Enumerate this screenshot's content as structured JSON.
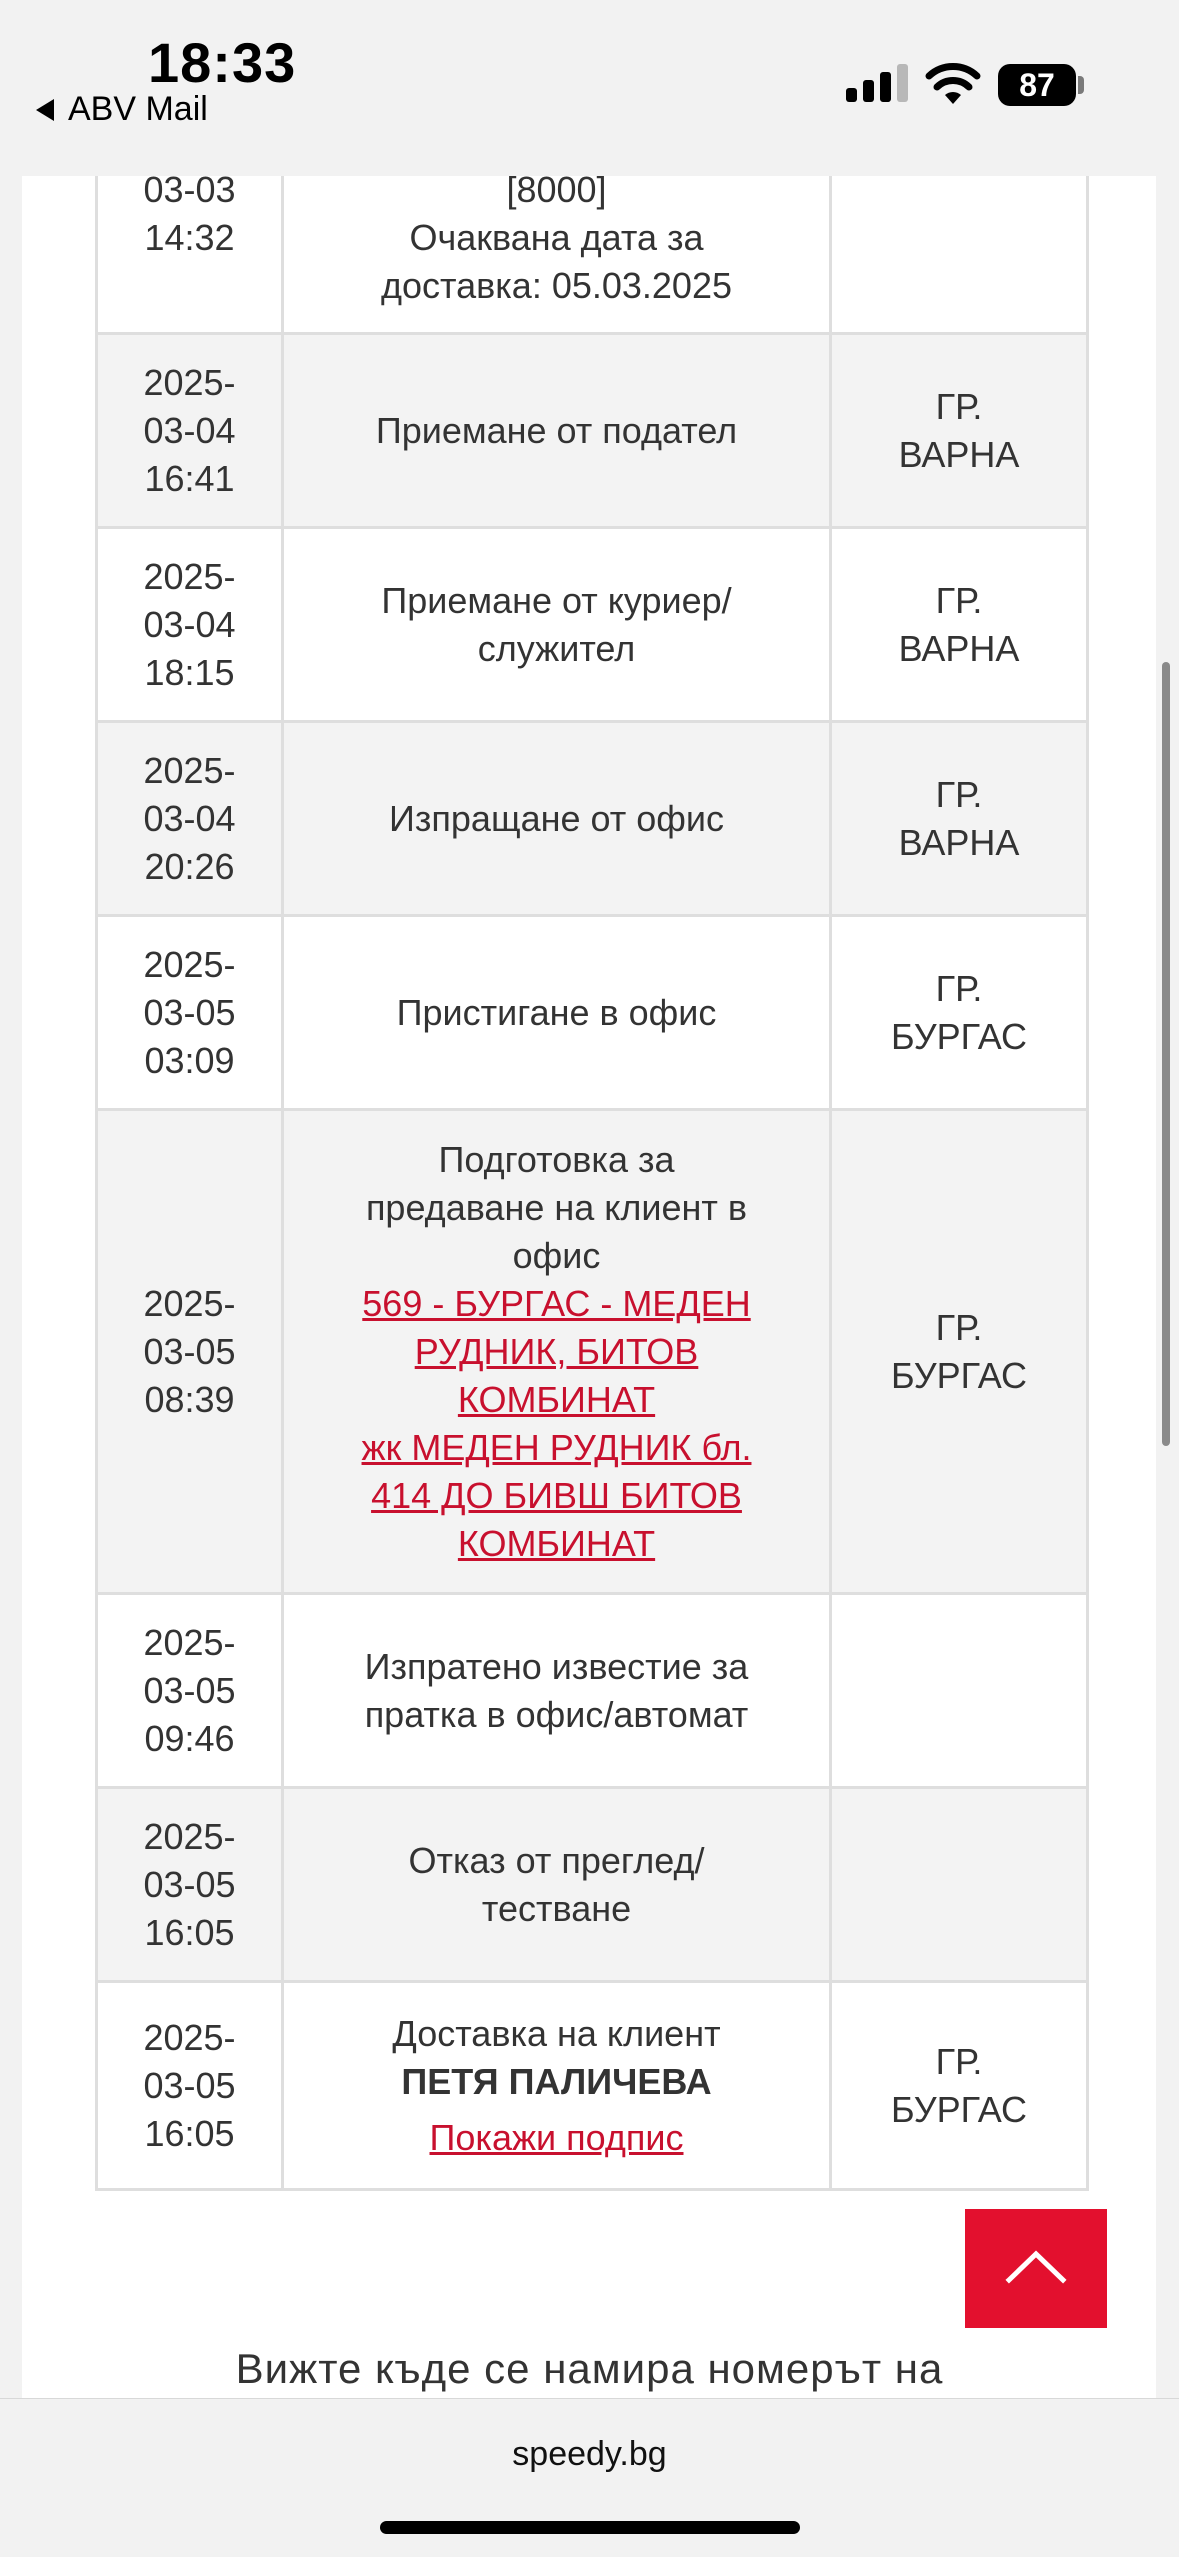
{
  "status_bar": {
    "time": "18:33",
    "back_app": "ABV Mail",
    "battery": "87"
  },
  "tracking_rows": [
    {
      "date": [
        "03-03",
        "14:32"
      ],
      "event": [
        "[8000]",
        "Очаквана дата за",
        "доставка: 05.03.2025"
      ],
      "location": []
    },
    {
      "date": [
        "2025-",
        "03-04",
        "16:41"
      ],
      "event": [
        "Приемане от подател"
      ],
      "location": [
        "ГР.",
        "ВАРНА"
      ]
    },
    {
      "date": [
        "2025-",
        "03-04",
        "18:15"
      ],
      "event": [
        "Приемане от куриер/",
        "служител"
      ],
      "location": [
        "ГР.",
        "ВАРНА"
      ]
    },
    {
      "date": [
        "2025-",
        "03-04",
        "20:26"
      ],
      "event": [
        "Изпращане от офис"
      ],
      "location": [
        "ГР.",
        "ВАРНА"
      ]
    },
    {
      "date": [
        "2025-",
        "03-05",
        "03:09"
      ],
      "event": [
        "Пристигане в офис"
      ],
      "location": [
        "ГР.",
        "БУРГАС"
      ]
    },
    {
      "date": [
        "2025-",
        "03-05",
        "08:39"
      ],
      "event": [
        "Подготовка за",
        "предаване на клиент в",
        "офис"
      ],
      "office_link": [
        "569 - БУРГАС - МЕДЕН",
        "РУДНИК, БИТОВ",
        "КОМБИНАТ"
      ],
      "address_link": [
        "жк МЕДЕН РУДНИК бл.",
        "414 ДО БИВШ БИТОВ",
        "КОМБИНАТ"
      ],
      "location": [
        "ГР.",
        "БУРГАС"
      ]
    },
    {
      "date": [
        "2025-",
        "03-05",
        "09:46"
      ],
      "event": [
        "Изпратено известие за",
        "пратка в офис/автомат"
      ],
      "location": []
    },
    {
      "date": [
        "2025-",
        "03-05",
        "16:05"
      ],
      "event": [
        "Отказ от преглед/",
        "тестване"
      ],
      "location": []
    },
    {
      "date": [
        "2025-",
        "03-05",
        "16:05"
      ],
      "event": [
        "Доставка на клиент"
      ],
      "recipient": "ПЕТЯ ПАЛИЧЕВА",
      "signature_link": "Покажи подпис",
      "location": [
        "ГР.",
        "БУРГАС"
      ]
    }
  ],
  "footer_hint": "Вижте къде се намира номерът на",
  "browser": {
    "url": "speedy.bg"
  },
  "colors": {
    "accent": "#e3102e",
    "link": "#c8102e"
  }
}
